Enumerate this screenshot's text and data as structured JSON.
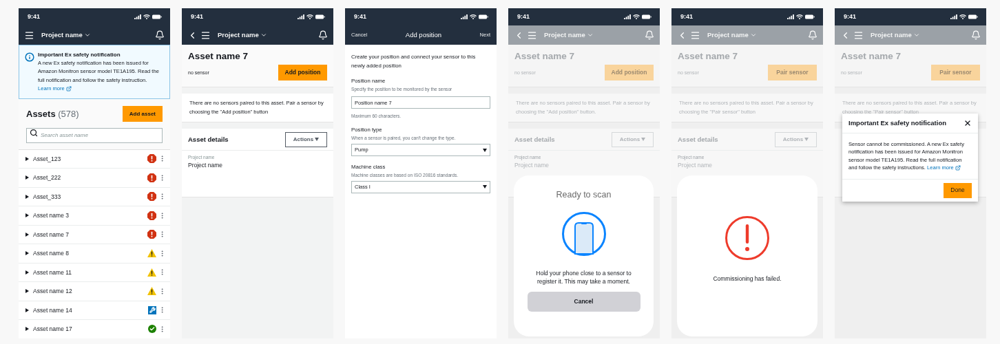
{
  "screens": [
    {
      "kind": "asset_list",
      "time": "9:41",
      "dimmed": false,
      "nav": {
        "kind": "main",
        "back": false,
        "title": "Project name"
      },
      "banner": {
        "title": "Important Ex safety notification",
        "body": "A new Ex safety notification has been issued for Amazon Monitron sensor model TE1A195. Read the full notification and follow the safety instruction.",
        "link": "Learn more"
      },
      "header": {
        "title": "Assets",
        "count": "(578)",
        "button": "Add asset"
      },
      "search": {
        "placeholder": "Search asset name"
      },
      "assets": [
        {
          "name": "Asset_123",
          "kind": "alarm"
        },
        {
          "name": "Asset_222",
          "kind": "alarm"
        },
        {
          "name": "Asset_333",
          "kind": "alarm"
        },
        {
          "name": "Asset name 3",
          "kind": "alarm"
        },
        {
          "name": "Asset name 7",
          "kind": "alarm"
        },
        {
          "name": "Asset name 8",
          "kind": "warning"
        },
        {
          "name": "Asset name 11",
          "kind": "warning"
        },
        {
          "name": "Asset name 12",
          "kind": "warning"
        },
        {
          "name": "Asset name 14",
          "kind": "maintenance"
        },
        {
          "name": "Asset name 17",
          "kind": "healthy"
        }
      ]
    },
    {
      "kind": "asset_detail",
      "time": "9:41",
      "dimmed": false,
      "nav": {
        "kind": "main",
        "back": true,
        "title": "Project name"
      },
      "asset": {
        "title": "Asset name 7",
        "sensor": "no sensor",
        "button": "Add position",
        "message": "There are no sensors paired to this asset. Pair a sensor by choosing the \"Add position\" button",
        "details_title": "Asset details",
        "actions": "Actions",
        "fields": [
          {
            "label": "Project name",
            "value": "Project name"
          }
        ]
      }
    },
    {
      "kind": "form",
      "time": "9:41",
      "dimmed": false,
      "nav": {
        "kind": "form",
        "left": "Cancel",
        "title": "Add position",
        "right": "Next"
      },
      "intro": "Create your position and connect your sensor to this newly added position",
      "fields": [
        {
          "kind": "text",
          "label": "Position name",
          "hint": "Specify the position to be monitored by the sensor",
          "value": "Position name 7",
          "note": "Maximum 60 characters."
        },
        {
          "kind": "select",
          "label": "Position type",
          "hint": "When a sensor is paired, you can't change the type.",
          "value": "Pump"
        },
        {
          "kind": "select",
          "label": "Machine class",
          "hint": "Machine classes are based on ISO 20816 standards.",
          "value": "Class I"
        }
      ]
    },
    {
      "kind": "asset_detail",
      "time": "9:41",
      "dimmed": true,
      "nav": {
        "kind": "main",
        "back": true,
        "title": "Project name"
      },
      "asset": {
        "title": "Asset name 7",
        "sensor": "no sensor",
        "button": "Add position",
        "message": "There are no sensors paired to this asset. Pair a sensor by choosing the \"Add position\" button.",
        "details_title": "Asset details",
        "actions": "Actions",
        "fields": [
          {
            "label": "Project name",
            "value": "Project name"
          }
        ]
      },
      "overlay": {
        "kind": "scan",
        "title": "Ready to scan",
        "text": "Hold your phone close to a sensor to register it. This may take a moment.",
        "button": "Cancel"
      }
    },
    {
      "kind": "asset_detail",
      "time": "9:41",
      "dimmed": true,
      "nav": {
        "kind": "main",
        "back": true,
        "title": "Project name"
      },
      "asset": {
        "title": "Asset name 7",
        "sensor": "no sensor",
        "button": "Pair sensor",
        "message": "There are no sensors paired to this asset. Pair a sensor by choosing the \"Pair sensor\" button",
        "details_title": "Asset details",
        "actions": "Actions",
        "fields": [
          {
            "label": "Project name",
            "value": "Project name"
          }
        ]
      },
      "overlay": {
        "kind": "failed",
        "text": "Commissioning has failed."
      }
    },
    {
      "kind": "asset_detail",
      "time": "9:41",
      "dimmed": true,
      "nav": {
        "kind": "main",
        "back": true,
        "title": "Project name"
      },
      "asset": {
        "title": "Asset name 7",
        "sensor": "no sensor",
        "button": "Pair sensor",
        "message": "There are no sensors paired to this asset. Pair a sensor by choosing the \"Pair sensor\" button"
      },
      "overlay": {
        "kind": "dialog",
        "title": "Important Ex safety notification",
        "body": "Sensor cannot be commissioned. A new Ex safety notification has been issued for Amazon Monitron sensor model TE1A195. Read the full notification and follow the safety instructions.",
        "link": "Learn more",
        "button": "Done"
      }
    }
  ]
}
